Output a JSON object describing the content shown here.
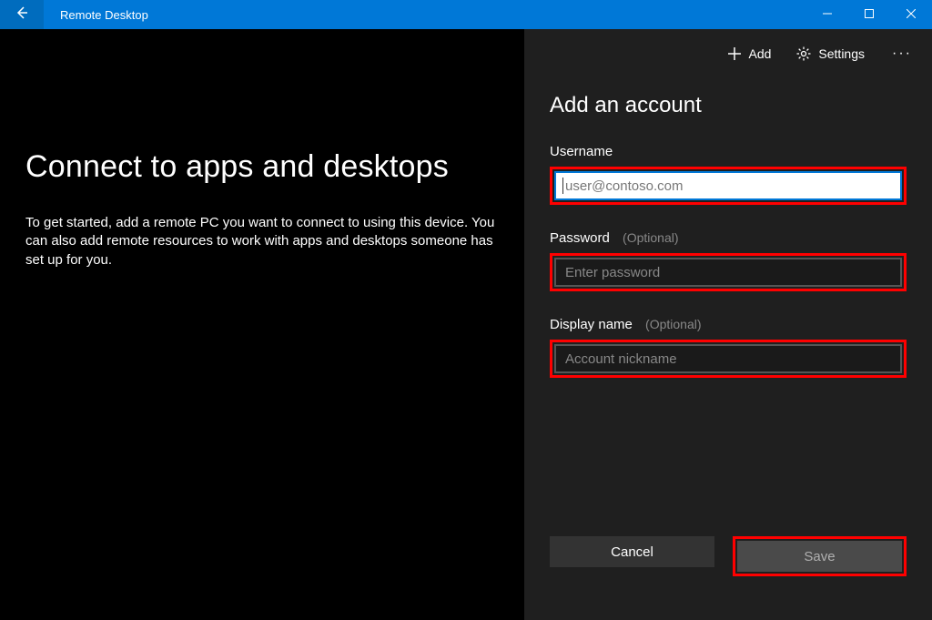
{
  "titlebar": {
    "app_title": "Remote Desktop"
  },
  "toolbar": {
    "add_label": "Add",
    "settings_label": "Settings"
  },
  "main": {
    "heading": "Connect to apps and desktops",
    "description": "To get started, add a remote PC you want to connect to using this device. You can also add remote resources to work with apps and desktops someone has set up for you."
  },
  "panel": {
    "heading": "Add an account",
    "username_label": "Username",
    "username_placeholder": "user@contoso.com",
    "username_value": "",
    "password_label": "Password",
    "password_optional": "(Optional)",
    "password_placeholder": "Enter password",
    "password_value": "",
    "displayname_label": "Display name",
    "displayname_optional": "(Optional)",
    "displayname_placeholder": "Account nickname",
    "displayname_value": "",
    "cancel_label": "Cancel",
    "save_label": "Save"
  },
  "highlight_color": "#ff0000",
  "accent_color": "#0078d7"
}
